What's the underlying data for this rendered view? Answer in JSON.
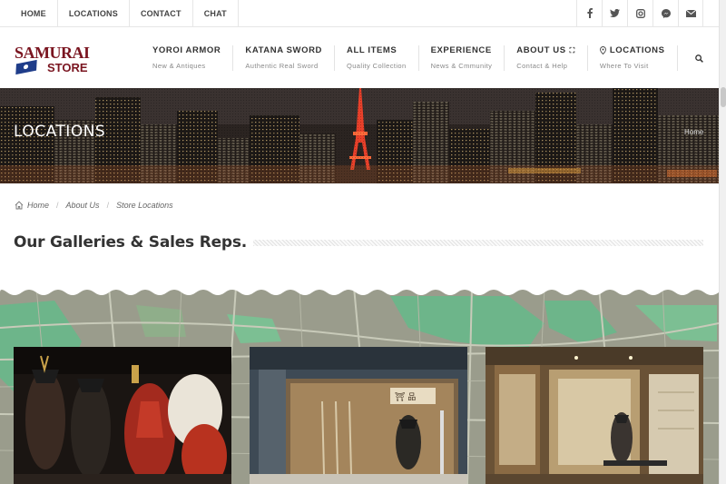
{
  "topbar": {
    "links": [
      "HOME",
      "LOCATIONS",
      "CONTACT",
      "CHAT"
    ],
    "social": [
      "facebook-icon",
      "twitter-icon",
      "instagram-icon",
      "messenger-icon",
      "mail-icon"
    ]
  },
  "brand": {
    "line1": "SAMURAI",
    "line2": "STORE"
  },
  "menu": [
    {
      "title": "YOROI ARMOR",
      "sub": "New & Antiques"
    },
    {
      "title": "KATANA SWORD",
      "sub": "Authentic Real Sword"
    },
    {
      "title": "ALL ITEMS",
      "sub": "Quality Collection"
    },
    {
      "title": "EXPERIENCE",
      "sub": "News & Cmmunity"
    },
    {
      "title": "ABOUT US",
      "sub": "Contact & Help"
    },
    {
      "title": "LOCATIONS",
      "sub": "Where To Visit"
    }
  ],
  "hero": {
    "title": "LOCATIONS",
    "crumb": "Home"
  },
  "breadcrumb": [
    "Home",
    "About Us",
    "Store Locations"
  ],
  "page": {
    "heading": "Our Galleries & Sales Reps."
  },
  "colors": {
    "brand": "#7a1520",
    "flag": "#1f3d8a",
    "map_green": "#6db58a",
    "map_grey": "#9a9c8c"
  }
}
